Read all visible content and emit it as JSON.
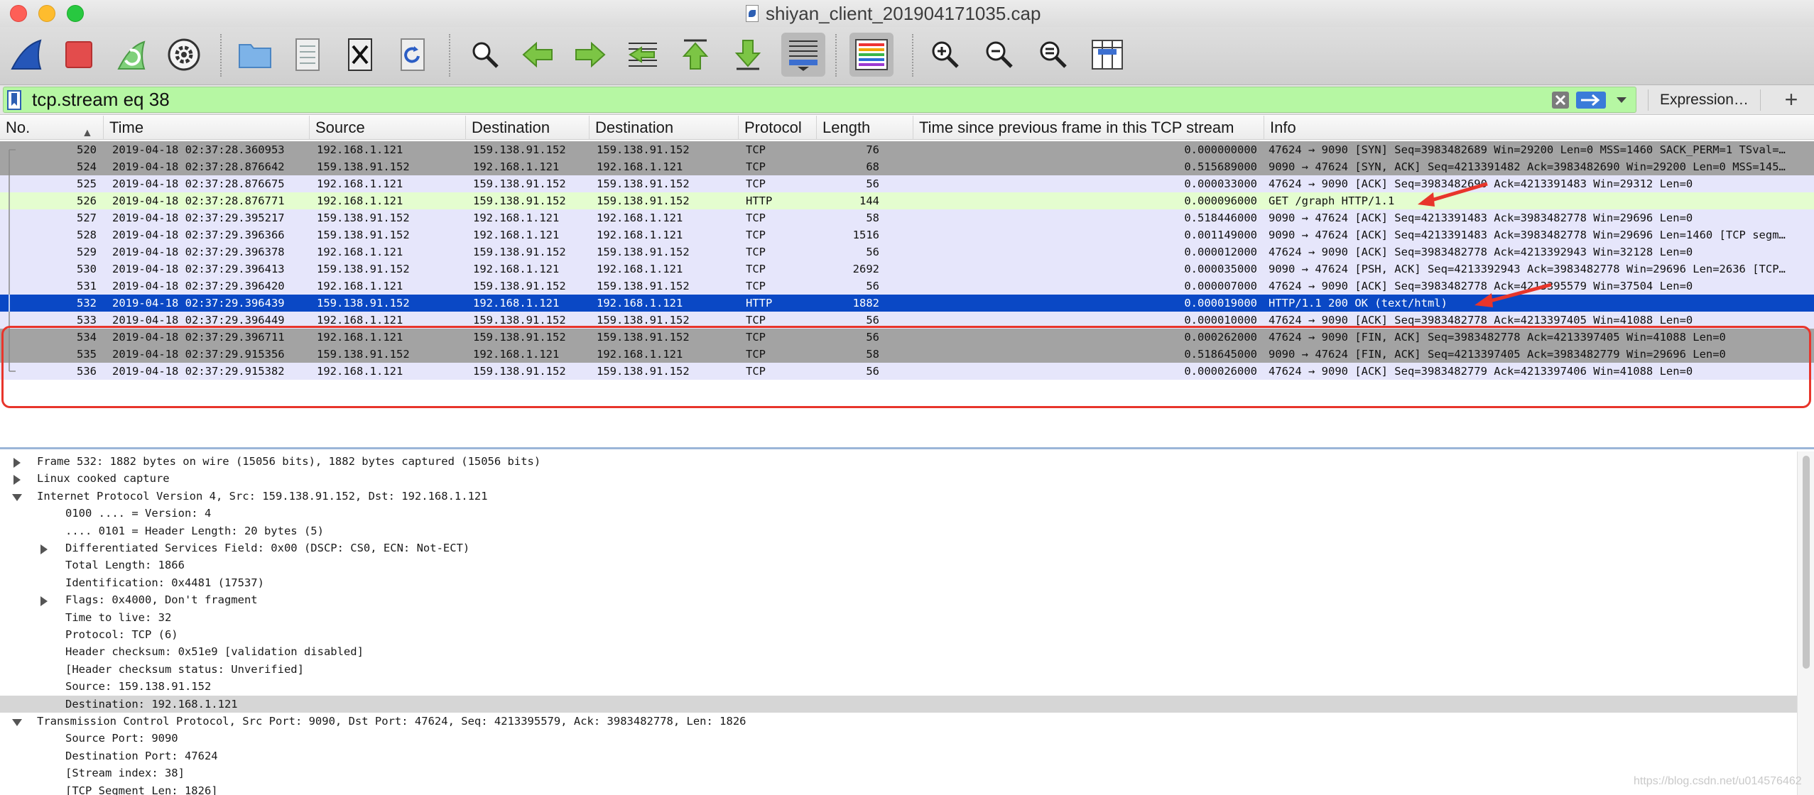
{
  "window": {
    "title": "shiyan_client_201904171035.cap"
  },
  "toolbar": {
    "buttons": [
      "start-capture-icon",
      "stop-capture-icon",
      "restart-capture-icon",
      "capture-options-icon",
      "open-file-icon",
      "save-file-icon",
      "close-file-icon",
      "reload-file-icon",
      "find-packet-icon",
      "go-back-icon",
      "go-forward-icon",
      "go-to-packet-icon",
      "go-first-icon",
      "go-last-icon",
      "autoscroll-icon",
      "colorize-icon",
      "zoom-in-icon",
      "zoom-out-icon",
      "zoom-normal-icon",
      "resize-columns-icon"
    ]
  },
  "filter": {
    "value": "tcp.stream eq 38",
    "expression_label": "Expression…",
    "add_label": "+"
  },
  "packet_list": {
    "columns": [
      "No.",
      "Time",
      "Source",
      "Destination",
      "Destination",
      "Protocol",
      "Length",
      "Time since previous frame in this TCP stream",
      "Info"
    ],
    "rows": [
      {
        "no": "520",
        "time": "2019-04-18 02:37:28.360953",
        "src": "192.168.1.121",
        "dst": "159.138.91.152",
        "dst2": "159.138.91.152",
        "proto": "TCP",
        "len": "76",
        "delta": "0.000000000",
        "info": "47624 → 9090 [SYN] Seq=3983482689 Win=29200 Len=0 MSS=1460 SACK_PERM=1 TSval=…",
        "bg": "#a3a3a3"
      },
      {
        "no": "524",
        "time": "2019-04-18 02:37:28.876642",
        "src": "159.138.91.152",
        "dst": "192.168.1.121",
        "dst2": "192.168.1.121",
        "proto": "TCP",
        "len": "68",
        "delta": "0.515689000",
        "info": "9090 → 47624 [SYN, ACK] Seq=4213391482 Ack=3983482690 Win=29200 Len=0 MSS=145…",
        "bg": "#a3a3a3"
      },
      {
        "no": "525",
        "time": "2019-04-18 02:37:28.876675",
        "src": "192.168.1.121",
        "dst": "159.138.91.152",
        "dst2": "159.138.91.152",
        "proto": "TCP",
        "len": "56",
        "delta": "0.000033000",
        "info": "47624 → 9090 [ACK] Seq=3983482690 Ack=4213391483 Win=29312 Len=0",
        "bg": "#e6e6fb"
      },
      {
        "no": "526",
        "time": "2019-04-18 02:37:28.876771",
        "src": "192.168.1.121",
        "dst": "159.138.91.152",
        "dst2": "159.138.91.152",
        "proto": "HTTP",
        "len": "144",
        "delta": "0.000096000",
        "info": "GET /graph HTTP/1.1",
        "bg": "#e4fdcf"
      },
      {
        "no": "527",
        "time": "2019-04-18 02:37:29.395217",
        "src": "159.138.91.152",
        "dst": "192.168.1.121",
        "dst2": "192.168.1.121",
        "proto": "TCP",
        "len": "58",
        "delta": "0.518446000",
        "info": "9090 → 47624 [ACK] Seq=4213391483 Ack=3983482778 Win=29696 Len=0",
        "bg": "#e6e6fb"
      },
      {
        "no": "528",
        "time": "2019-04-18 02:37:29.396366",
        "src": "159.138.91.152",
        "dst": "192.168.1.121",
        "dst2": "192.168.1.121",
        "proto": "TCP",
        "len": "1516",
        "delta": "0.001149000",
        "info": "9090 → 47624 [ACK] Seq=4213391483 Ack=3983482778 Win=29696 Len=1460 [TCP segm…",
        "bg": "#e6e6fb"
      },
      {
        "no": "529",
        "time": "2019-04-18 02:37:29.396378",
        "src": "192.168.1.121",
        "dst": "159.138.91.152",
        "dst2": "159.138.91.152",
        "proto": "TCP",
        "len": "56",
        "delta": "0.000012000",
        "info": "47624 → 9090 [ACK] Seq=3983482778 Ack=4213392943 Win=32128 Len=0",
        "bg": "#e6e6fb"
      },
      {
        "no": "530",
        "time": "2019-04-18 02:37:29.396413",
        "src": "159.138.91.152",
        "dst": "192.168.1.121",
        "dst2": "192.168.1.121",
        "proto": "TCP",
        "len": "2692",
        "delta": "0.000035000",
        "info": "9090 → 47624 [PSH, ACK] Seq=4213392943 Ack=3983482778 Win=29696 Len=2636 [TCP…",
        "bg": "#e6e6fb"
      },
      {
        "no": "531",
        "time": "2019-04-18 02:37:29.396420",
        "src": "192.168.1.121",
        "dst": "159.138.91.152",
        "dst2": "159.138.91.152",
        "proto": "TCP",
        "len": "56",
        "delta": "0.000007000",
        "info": "47624 → 9090 [ACK] Seq=3983482778 Ack=4213395579 Win=37504 Len=0",
        "bg": "#e6e6fb"
      },
      {
        "no": "532",
        "time": "2019-04-18 02:37:29.396439",
        "src": "159.138.91.152",
        "dst": "192.168.1.121",
        "dst2": "192.168.1.121",
        "proto": "HTTP",
        "len": "1882",
        "delta": "0.000019000",
        "info": "HTTP/1.1 200 OK  (text/html)",
        "bg": "#0a48c5"
      },
      {
        "no": "533",
        "time": "2019-04-18 02:37:29.396449",
        "src": "192.168.1.121",
        "dst": "159.138.91.152",
        "dst2": "159.138.91.152",
        "proto": "TCP",
        "len": "56",
        "delta": "0.000010000",
        "info": "47624 → 9090 [ACK] Seq=3983482778 Ack=4213397405 Win=41088 Len=0",
        "bg": "#e6e6fb"
      },
      {
        "no": "534",
        "time": "2019-04-18 02:37:29.396711",
        "src": "192.168.1.121",
        "dst": "159.138.91.152",
        "dst2": "159.138.91.152",
        "proto": "TCP",
        "len": "56",
        "delta": "0.000262000",
        "info": "47624 → 9090 [FIN, ACK] Seq=3983482778 Ack=4213397405 Win=41088 Len=0",
        "bg": "#a3a3a3"
      },
      {
        "no": "535",
        "time": "2019-04-18 02:37:29.915356",
        "src": "159.138.91.152",
        "dst": "192.168.1.121",
        "dst2": "192.168.1.121",
        "proto": "TCP",
        "len": "58",
        "delta": "0.518645000",
        "info": "9090 → 47624 [FIN, ACK] Seq=4213397405 Ack=3983482779 Win=29696 Len=0",
        "bg": "#a3a3a3"
      },
      {
        "no": "536",
        "time": "2019-04-18 02:37:29.915382",
        "src": "192.168.1.121",
        "dst": "159.138.91.152",
        "dst2": "159.138.91.152",
        "proto": "TCP",
        "len": "56",
        "delta": "0.000026000",
        "info": "47624 → 9090 [ACK] Seq=3983482779 Ack=4213397406 Win=41088 Len=0",
        "bg": "#e6e6fb"
      }
    ]
  },
  "details": [
    {
      "text": "Frame 532: 1882 bytes on wire (15056 bits), 1882 bytes captured (15056 bits)",
      "indent": 0,
      "tri": "closed"
    },
    {
      "text": "Linux cooked capture",
      "indent": 0,
      "tri": "closed"
    },
    {
      "text": "Internet Protocol Version 4, Src: 159.138.91.152, Dst: 192.168.1.121",
      "indent": 0,
      "tri": "open"
    },
    {
      "text": "0100 .... = Version: 4",
      "indent": 1,
      "tri": "none"
    },
    {
      "text": ".... 0101 = Header Length: 20 bytes (5)",
      "indent": 1,
      "tri": "none"
    },
    {
      "text": "Differentiated Services Field: 0x00 (DSCP: CS0, ECN: Not-ECT)",
      "indent": 1,
      "tri": "closed"
    },
    {
      "text": "Total Length: 1866",
      "indent": 1,
      "tri": "none"
    },
    {
      "text": "Identification: 0x4481 (17537)",
      "indent": 1,
      "tri": "none"
    },
    {
      "text": "Flags: 0x4000, Don't fragment",
      "indent": 1,
      "tri": "closed"
    },
    {
      "text": "Time to live: 32",
      "indent": 1,
      "tri": "none"
    },
    {
      "text": "Protocol: TCP (6)",
      "indent": 1,
      "tri": "none"
    },
    {
      "text": "Header checksum: 0x51e9 [validation disabled]",
      "indent": 1,
      "tri": "none"
    },
    {
      "text": "[Header checksum status: Unverified]",
      "indent": 1,
      "tri": "none"
    },
    {
      "text": "Source: 159.138.91.152",
      "indent": 1,
      "tri": "none"
    },
    {
      "text": "Destination: 192.168.1.121",
      "indent": 1,
      "tri": "none",
      "selected": true
    },
    {
      "text": "Transmission Control Protocol, Src Port: 9090, Dst Port: 47624, Seq: 4213395579, Ack: 3983482778, Len: 1826",
      "indent": 0,
      "tri": "open"
    },
    {
      "text": "Source Port: 9090",
      "indent": 1,
      "tri": "none"
    },
    {
      "text": "Destination Port: 47624",
      "indent": 1,
      "tri": "none"
    },
    {
      "text": "[Stream index: 38]",
      "indent": 1,
      "tri": "none"
    },
    {
      "text": "[TCP Segment Len: 1826]",
      "indent": 1,
      "tri": "none"
    }
  ],
  "watermark": "https://blog.csdn.net/u014576462",
  "colors": {
    "selected_row": "#0a48c5",
    "annotation": "#e8352b",
    "filter_valid": "#b6f7a3"
  }
}
